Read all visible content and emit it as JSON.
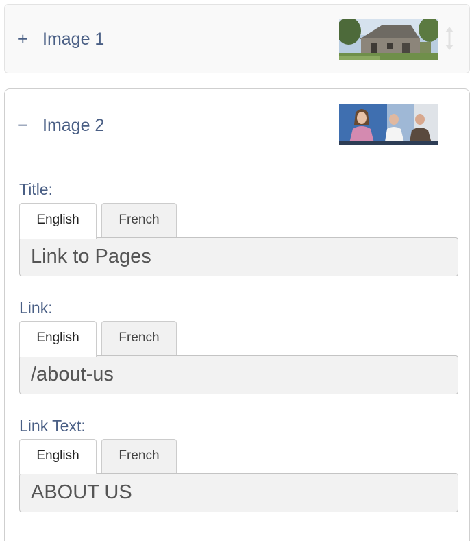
{
  "items": [
    {
      "toggle_symbol": "+",
      "title": "Image 1",
      "expanded": false,
      "thumbnail": "stone-barn-photo"
    },
    {
      "toggle_symbol": "−",
      "title": "Image 2",
      "expanded": true,
      "thumbnail": "meeting-people-photo"
    }
  ],
  "fields": {
    "title": {
      "label": "Title:",
      "tabs": [
        "English",
        "French"
      ],
      "active_tab": "English",
      "value": "Link to Pages"
    },
    "link": {
      "label": "Link:",
      "tabs": [
        "English",
        "French"
      ],
      "active_tab": "English",
      "value": "/about-us"
    },
    "link_text": {
      "label": "Link Text:",
      "tabs": [
        "English",
        "French"
      ],
      "active_tab": "English",
      "value": "ABOUT US"
    }
  },
  "colors": {
    "label": "#4a5f85",
    "input_bg": "#f2f2f2",
    "border": "#cccccc"
  },
  "icons": [
    "plus-icon",
    "minus-icon",
    "drag-handle-icon"
  ]
}
